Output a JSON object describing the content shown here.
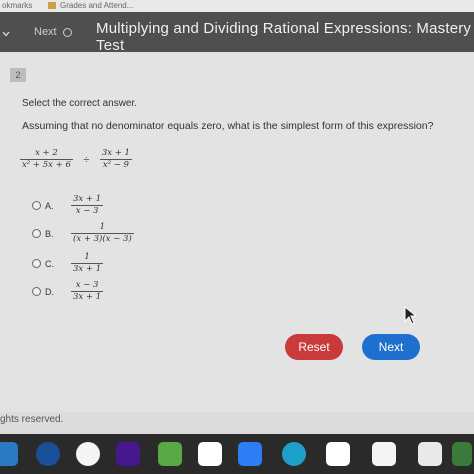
{
  "browser": {
    "bookmarks_label": "okmarks",
    "bookmark_item": "Grades and Attend..."
  },
  "header": {
    "next_label": "Next",
    "title": "Multiplying and Dividing Rational Expressions: Mastery Test"
  },
  "question": {
    "number": "2",
    "instruction": "Select the correct answer.",
    "prompt": "Assuming that no denominator equals zero, what is the simplest form of this expression?",
    "expression": {
      "left_num": "x + 2",
      "left_den": "x² + 5x + 6",
      "operator": "÷",
      "right_num": "3x + 1",
      "right_den": "x² − 9"
    },
    "options": [
      {
        "label": "A.",
        "num": "3x + 1",
        "den": "x − 3"
      },
      {
        "label": "B.",
        "num": "1",
        "den": "(x + 3)(x − 3)"
      },
      {
        "label": "C.",
        "num": "1",
        "den": "3x + 1"
      },
      {
        "label": "D.",
        "num": "x − 3",
        "den": "3x + 1"
      }
    ]
  },
  "buttons": {
    "reset": "Reset",
    "next": "Next"
  },
  "footer": {
    "rights": "ghts reserved."
  },
  "colors": {
    "reset": "#c93a3a",
    "next": "#1f6fcf",
    "header": "#4f4f4f"
  }
}
